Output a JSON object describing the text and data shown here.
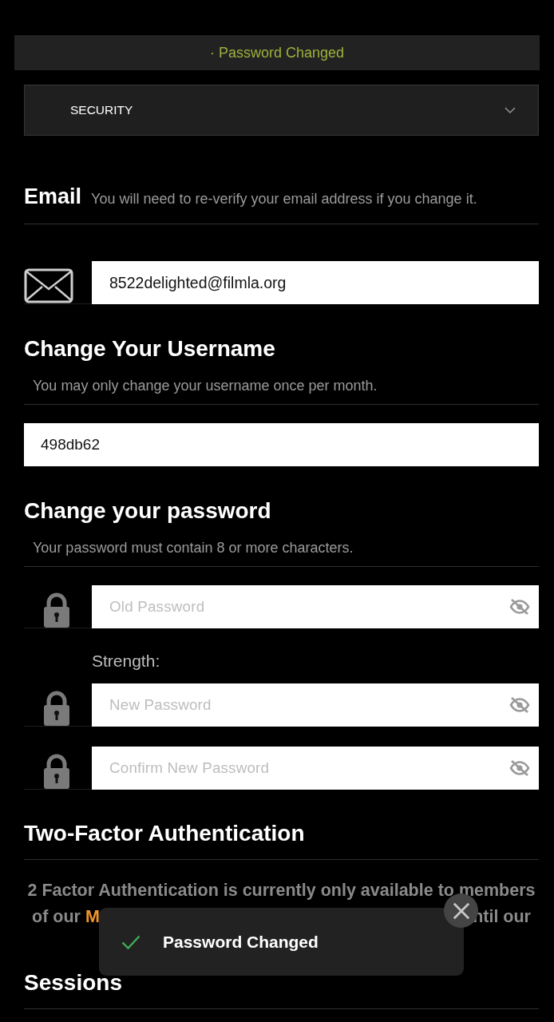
{
  "banner": {
    "text": "· Password Changed"
  },
  "section_select": {
    "value": "SECURITY"
  },
  "email": {
    "title": "Email",
    "hint": "You will need to re-verify your email address if you change it.",
    "value": "8522delighted@filmla.org"
  },
  "username": {
    "title": "Change Your Username",
    "hint": "You may only change your username once per month.",
    "value": "498db62"
  },
  "password": {
    "title": "Change your password",
    "hint": "Your password must contain 8 or more characters.",
    "rows": [
      {
        "kind": "field",
        "placeholder": "Old Password"
      },
      {
        "kind": "label",
        "text": "Strength:"
      },
      {
        "kind": "field",
        "placeholder": "New Password"
      },
      {
        "kind": "field",
        "placeholder": "Confirm New Password"
      }
    ]
  },
  "two_factor": {
    "title": "Two-Factor Authentication",
    "line_1": "2 Factor Authentication is currently only available to members",
    "line_2": {
      "before": "of our",
      "link": "M",
      "after": "ntil our"
    }
  },
  "sessions": {
    "title": "Sessions"
  },
  "toast": {
    "message": "Password Changed"
  }
}
